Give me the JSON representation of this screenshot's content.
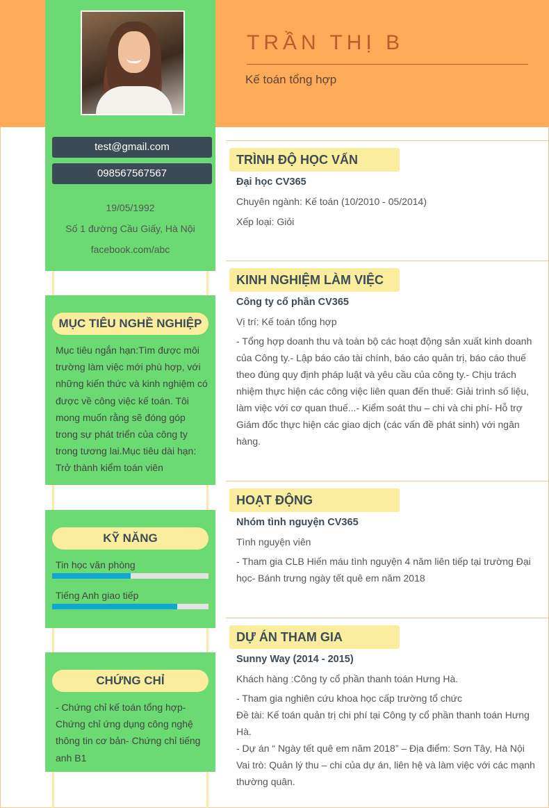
{
  "profile": {
    "name": "TRẦN THỊ B",
    "job_title": "Kế toán tổng hợp",
    "email": "test@gmail.com",
    "phone": "098567567567",
    "birthday": "19/05/1992",
    "address": "Số 1 đường Cầu Giấy, Hà Nội",
    "facebook": "facebook.com/abc"
  },
  "objective": {
    "title": "MỤC TIÊU NGHỀ NGHIỆP",
    "lines": [
      "Mục tiêu ngắn hạn:Tìm được môi",
      "trường làm việc mới phù hợp, với",
      "những kiến thức và kinh nghiệm có",
      "được về công việc kế toán. Tôi",
      "mong muốn rằng sẽ đóng góp",
      "trong sự phát triển của công ty",
      "trong tương lai.Mục tiêu dài hạn:",
      "Trở thành kiểm toán viên"
    ]
  },
  "skills": {
    "title": "KỸ NĂNG",
    "items": [
      {
        "name": "Tin học văn phòng",
        "level": 0.5
      },
      {
        "name": "Tiếng Anh giao tiếp",
        "level": 0.8
      }
    ]
  },
  "certificates": {
    "title": "CHỨNG CHỈ",
    "lines": [
      "- Chứng chỉ kế toán tổng hợp-",
      "Chứng chỉ ứng dụng công nghệ",
      "thông tin cơ bản- Chứng chỉ tiếng",
      "anh B1"
    ]
  },
  "education": {
    "title": "TRÌNH ĐỘ HỌC VẤN",
    "school": "Đại học CV365",
    "major": "Chuyên ngành: Kế toán (10/2010 - 05/2014)",
    "grade": "Xếp loại: Giỏi"
  },
  "experience": {
    "title": "KINH NGHIỆM LÀM VIỆC",
    "company": "Công ty cổ phần CV365",
    "position": "Vị trí: Kế toán tổng hợp",
    "lines": [
      "- Tổng hợp doanh thu và toàn bộ các hoạt động sản xuất kinh doanh",
      "của Công ty.- Lập báo cáo tài chính, báo cáo quản trị, báo cáo thuế",
      "theo đúng quy định pháp luật và yêu cầu của công ty.- Chịu trách",
      "nhiệm thực hiện các công việc liên quan đến thuế: Giải trình số liệu,",
      "làm việc với cơ quan thuế...- Kiểm soát thu – chi và chi phí- Hỗ trợ",
      "Giám đốc thực hiện các giao dịch (các vấn đề phát sinh) với ngân",
      "hàng."
    ]
  },
  "activities": {
    "title": "HOẠT ĐỘNG",
    "org": "Nhóm tình nguyện CV365",
    "role": "Tình nguyện viên",
    "lines": [
      "- Tham gia CLB Hiến máu tình nguyện 4 năm liên tiếp tại trường Đại",
      "học- Bánh trưng ngày tết quê em năm 2018"
    ]
  },
  "projects": {
    "title": "DỰ ÁN THAM GIA",
    "name": "Sunny Way (2014 - 2015)",
    "client": "Khách hàng :Công ty cổ phần thanh toán Hưng Hà.",
    "lines": [
      "- Tham gia nghiên cứu khoa học cấp trường tổ chức",
      "Đề tài: Kế toán quản trị chi phí  tại Công ty cổ phần thanh toán Hưng",
      "Hà.",
      "- Dự án “ Ngày tết quê em năm 2018” – Địa điểm: Sơn Tây, Hà Nội",
      "Vai trò: Quản lý thu – chi của dự án, liên hệ và làm việc với các mạnh",
      "thường quân."
    ]
  },
  "colors": {
    "header": "#fdab59",
    "sidebar": "#6bda72",
    "section_label": "#fbed9e",
    "dark_pill": "#3b4a57",
    "skill_bar": "#10a7d6",
    "name": "#bb5b2f"
  }
}
